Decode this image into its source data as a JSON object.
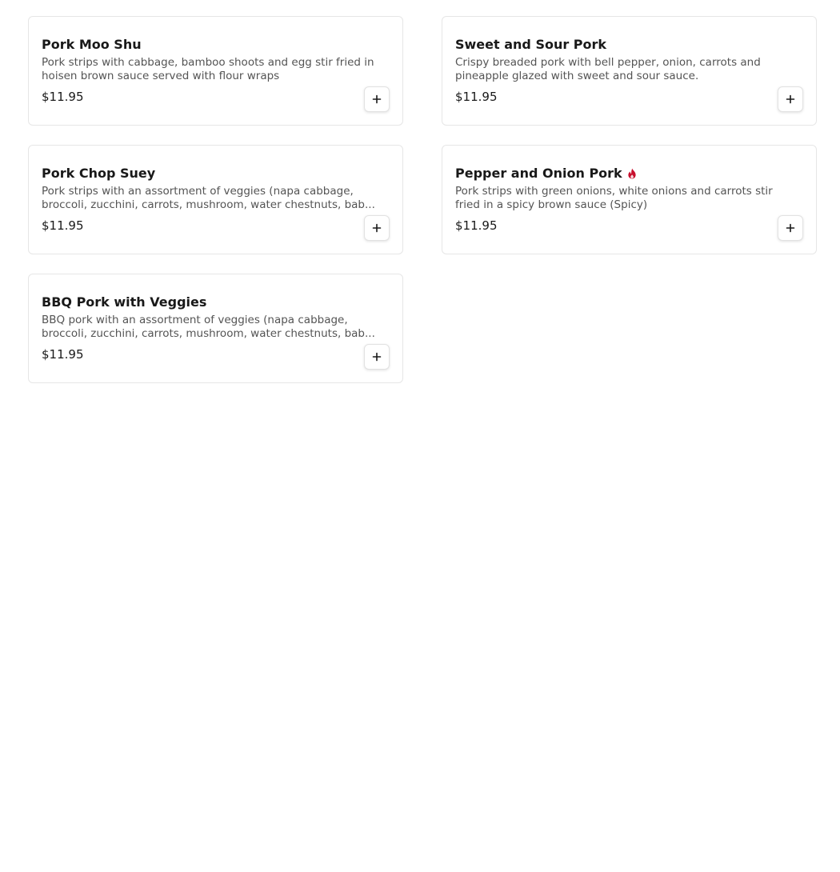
{
  "menu": {
    "items": [
      {
        "name": "Pork Moo Shu",
        "description": "Pork strips with cabbage, bamboo shoots and egg stir fried in hoisen brown sauce served with flour wraps",
        "price": "$11.95",
        "spicy": false
      },
      {
        "name": "Sweet and Sour Pork",
        "description": "Crispy breaded pork with bell pepper, onion, carrots and pineapple glazed with sweet and sour sauce.",
        "price": "$11.95",
        "spicy": false
      },
      {
        "name": "Pork Chop Suey",
        "description": "Pork strips with an assortment of veggies (napa cabbage, broccoli, zucchini, carrots, mushroom, water chestnuts, bab...",
        "price": "$11.95",
        "spicy": false
      },
      {
        "name": "Pepper and Onion Pork",
        "description": "Pork strips with green onions, white onions and carrots stir fried in a spicy brown sauce (Spicy)",
        "price": "$11.95",
        "spicy": true
      },
      {
        "name": "BBQ Pork with Veggies",
        "description": "BBQ pork with an assortment of veggies (napa cabbage, broccoli, zucchini, carrots, mushroom, water chestnuts, bab...",
        "price": "$11.95",
        "spicy": false
      }
    ],
    "icons": {
      "add": "plus-icon",
      "spicy": "flame-icon"
    },
    "colors": {
      "spicy": "#c8102e",
      "border": "#e6e6e6",
      "text": "#191919",
      "muted": "#545454"
    }
  }
}
